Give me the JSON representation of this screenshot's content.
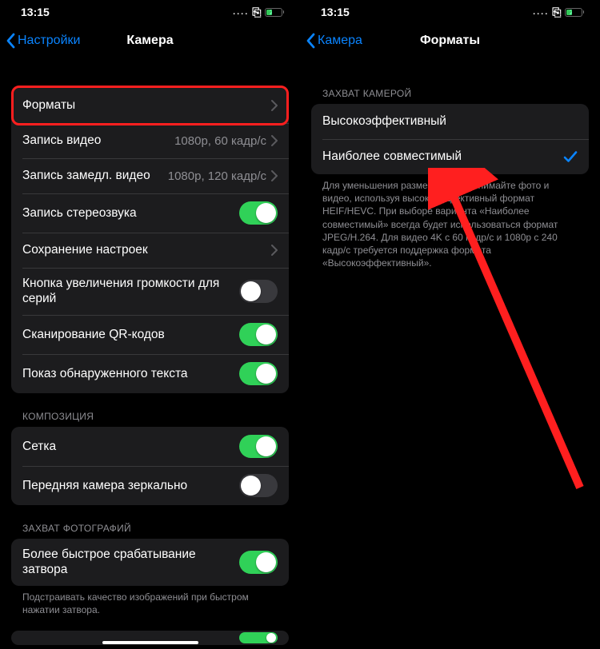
{
  "status": {
    "time": "13:15",
    "battery_pct": "27"
  },
  "left": {
    "back_label": "Настройки",
    "title": "Камера",
    "groups": {
      "g1": {
        "formats": "Форматы",
        "record_video": "Запись видео",
        "record_video_detail": "1080p, 60 кадр/с",
        "slomo": "Запись замедл. видео",
        "slomo_detail": "1080p, 120 кадр/с",
        "stereo": "Запись стереозвука",
        "save_settings": "Сохранение настроек",
        "volume_burst": "Кнопка увеличения громкости для серий",
        "qr": "Сканирование QR-кодов",
        "detected_text": "Показ обнаруженного текста"
      },
      "composition": {
        "header": "КОМПОЗИЦИЯ",
        "grid": "Сетка",
        "mirror_front": "Передняя камера зеркально"
      },
      "capture": {
        "header": "ЗАХВАТ ФОТОГРАФИЙ",
        "faster_shutter": "Более быстрое срабатывание затвора",
        "footer": "Подстраивать качество изображений при быстром нажатии затвора."
      }
    }
  },
  "right": {
    "back_label": "Камера",
    "title": "Форматы",
    "group_header": "ЗАХВАТ КАМЕРОЙ",
    "opt_efficient": "Высокоэффективный",
    "opt_compatible": "Наиболее совместимый",
    "footer": "Для уменьшения размера файла снимайте фото и видео, используя высокоэффективный формат HEIF/HEVC. При выборе варианта «Наиболее совместимый» всегда будет использоваться формат JPEG/H.264. Для видео 4K с 60 кадр/с и 1080p с 240 кадр/с требуется поддержка формата «Высокоэффективный»."
  }
}
